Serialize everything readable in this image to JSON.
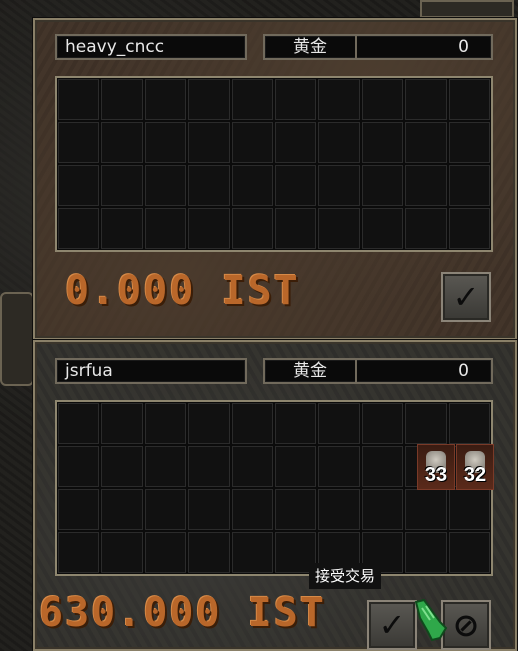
{
  "top_panel": {
    "player_name": "heavy_cncc",
    "gold_label": "黄金",
    "gold_value": "0",
    "amount_text": "0.000 IST",
    "confirm_icon": "check-icon"
  },
  "bottom_panel": {
    "player_name": "jsrfua",
    "gold_label": "黄金",
    "gold_value": "0",
    "amount_text": "630.000 IST",
    "items": [
      {
        "count": "33",
        "icon": "gem-icon"
      },
      {
        "count": "32",
        "icon": "gem-icon"
      }
    ],
    "accept_tooltip": "接受交易",
    "accept_icon": "check-icon",
    "cancel_icon": "cancel-icon"
  },
  "colors": {
    "amount": "#b9672a",
    "top_bg": "#3d3026",
    "bottom_bg": "#2f2e2b"
  }
}
